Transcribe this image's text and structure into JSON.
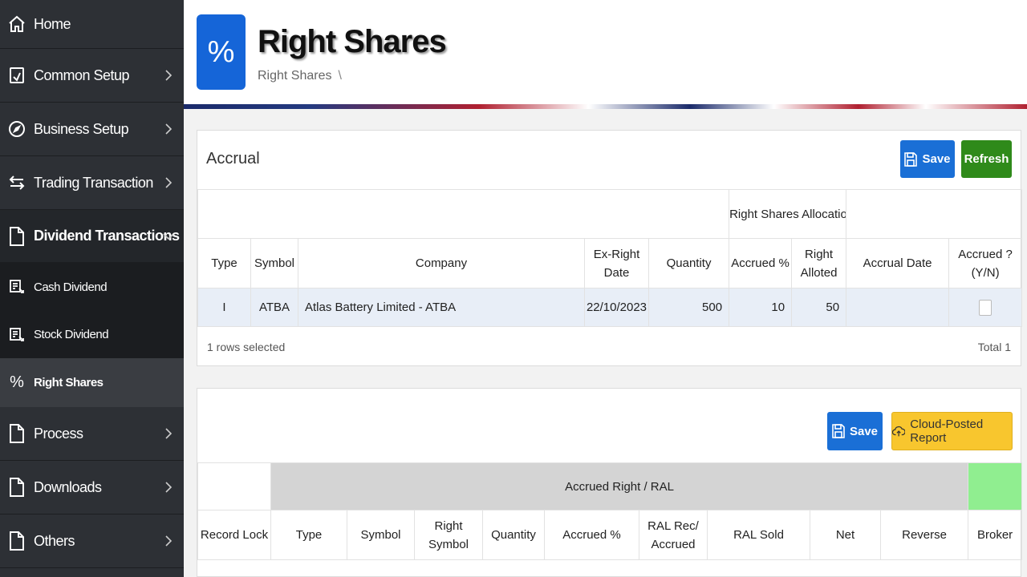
{
  "sidebar": {
    "items": [
      {
        "label": "Home",
        "icon": "home-icon"
      },
      {
        "label": "Common Setup",
        "icon": "setup-icon"
      },
      {
        "label": "Business Setup",
        "icon": "compass-icon"
      },
      {
        "label": "Trading Transaction",
        "icon": "transfer-icon"
      },
      {
        "label": "Dividend Transactions",
        "icon": "document-icon"
      },
      {
        "label": "Process",
        "icon": "document-icon"
      },
      {
        "label": "Downloads",
        "icon": "document-icon"
      },
      {
        "label": "Others",
        "icon": "document-icon"
      }
    ],
    "subitems": [
      {
        "label": "Cash Dividend",
        "icon": "report-icon"
      },
      {
        "label": "Stock Dividend",
        "icon": "report-icon"
      },
      {
        "label": "Right Shares",
        "icon": "percent-icon"
      }
    ]
  },
  "header": {
    "icon_glyph": "%",
    "title": "Right Shares",
    "breadcrumb": "Right Shares",
    "breadcrumb_sep": "\\"
  },
  "accrual": {
    "title": "Accrual",
    "save_label": "Save",
    "refresh_label": "Refresh",
    "group_header": "Right Shares Allocation",
    "columns": [
      "Type",
      "Symbol",
      "Company",
      "Ex-Right Date",
      "Quantity",
      "Accrued %",
      "Right Alloted",
      "Accrual Date",
      "Accrued ? (Y/N)"
    ],
    "rows": [
      {
        "type": "I",
        "symbol": "ATBA",
        "company": "Atlas Battery Limited - ATBA",
        "ex_right_date": "22/10/2023",
        "quantity": "500",
        "accrued_pct": "10",
        "right_alloted": "50",
        "accrual_date": ""
      }
    ],
    "footer_selected": "1 rows selected",
    "footer_total": "Total 1"
  },
  "accrued": {
    "save_label": "Save",
    "report_label": "Cloud-Posted Report",
    "group_header": "Accrued Right / RAL",
    "columns": [
      "Record Lock",
      "Type",
      "Symbol",
      "Right Symbol",
      "Quantity",
      "Accrued %",
      "RAL Rec/ Accrued",
      "RAL Sold",
      "Net",
      "Reverse",
      "Broker"
    ]
  },
  "colors": {
    "sidebar_bg": "#2d3035",
    "primary": "#1a6fd6",
    "refresh": "#2f8a1a",
    "report": "#f8c62e",
    "broker_band": "#90ee90"
  }
}
